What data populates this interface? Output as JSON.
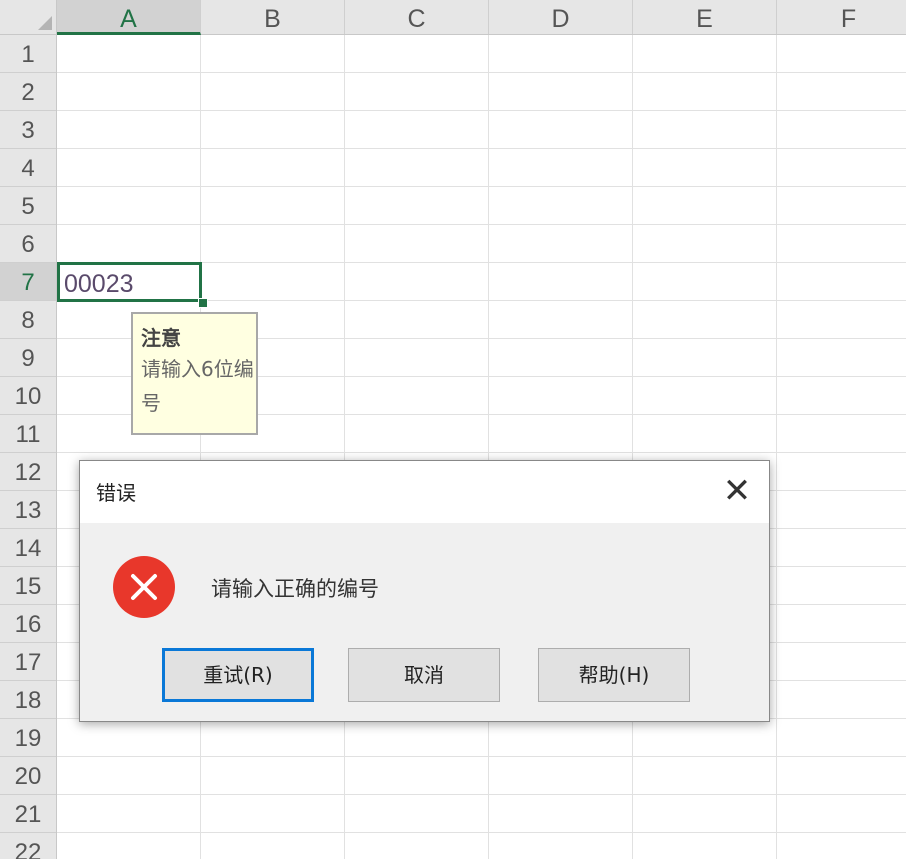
{
  "spreadsheet": {
    "columns": [
      "A",
      "B",
      "C",
      "D",
      "E",
      "F"
    ],
    "rows": [
      "1",
      "2",
      "3",
      "4",
      "5",
      "6",
      "7",
      "8",
      "9",
      "10",
      "11",
      "12",
      "13",
      "14",
      "15",
      "16",
      "17",
      "18",
      "19",
      "20",
      "21",
      "22"
    ],
    "active_column": "A",
    "active_row": "7",
    "active_cell_value": "00023"
  },
  "input_message": {
    "title": "注意",
    "body": "请输入6位编号"
  },
  "dialog": {
    "title": "错误",
    "close_glyph": "✕",
    "message": "请输入正确的编号",
    "buttons": {
      "retry": "重试(R)",
      "cancel": "取消",
      "help": "帮助(H)"
    }
  },
  "colors": {
    "selection_green": "#217346",
    "error_red": "#e8372b",
    "default_button_blue": "#0a78d7",
    "tooltip_yellow": "#ffffe1"
  }
}
